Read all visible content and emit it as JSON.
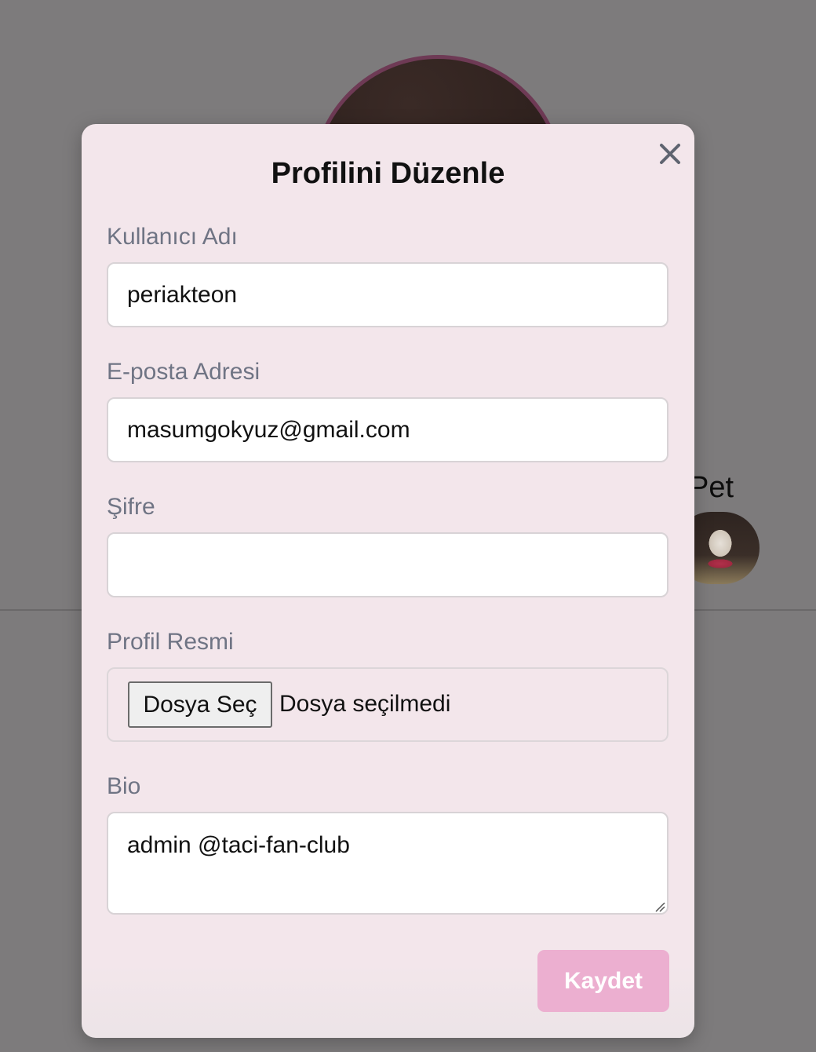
{
  "background": {
    "profile_name_partial": "Pet"
  },
  "modal": {
    "title": "Profilini Düzenle",
    "close_icon": "close-icon",
    "fields": {
      "username": {
        "label": "Kullanıcı Adı",
        "value": "periakteon"
      },
      "email": {
        "label": "E-posta Adresi",
        "value": "masumgokyuz@gmail.com"
      },
      "password": {
        "label": "Şifre",
        "value": ""
      },
      "avatar": {
        "label": "Profil Resmi",
        "button_label": "Dosya Seç",
        "status": "Dosya seçilmedi"
      },
      "bio": {
        "label": "Bio",
        "value": "admin @taci-fan-club"
      }
    },
    "save_label": "Kaydet"
  },
  "colors": {
    "backdrop": "#7d7b7c",
    "modal_bg": "#f3e6eb",
    "label_text": "#6f7484",
    "save_button": "#ecafd0",
    "avatar_ring": "#6e3a55"
  }
}
